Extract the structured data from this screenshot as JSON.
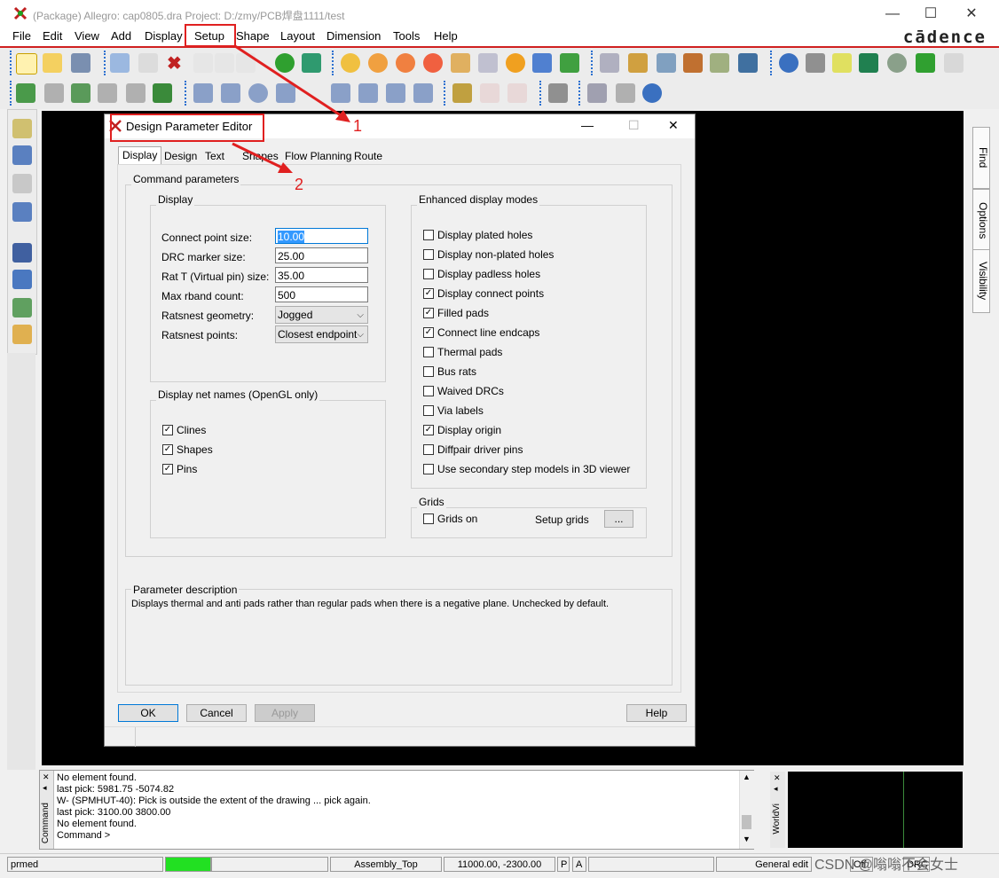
{
  "window": {
    "title": "(Package) Allegro: cap0805.dra  Project: D:/zmy/PCB焊盘1111/test",
    "minimize": "—",
    "maximize": "☐",
    "close": "✕"
  },
  "menu": {
    "items": [
      "File",
      "Edit",
      "View",
      "Add",
      "Display",
      "Setup",
      "Shape",
      "Layout",
      "Dimension",
      "Tools",
      "Help"
    ],
    "brand": "cādence"
  },
  "right_tabs": [
    "Find",
    "Options",
    "Visibility"
  ],
  "dialog": {
    "title": "Design Parameter Editor",
    "tabs": [
      "Display",
      "Design",
      "Text",
      "Shapes",
      "Flow Planning",
      "Route"
    ],
    "active_tab": "Display",
    "command_parameters_label": "Command parameters",
    "display_group": {
      "label": "Display",
      "fields": [
        {
          "label": "Connect point size:",
          "value": "10.00"
        },
        {
          "label": "DRC marker size:",
          "value": "25.00"
        },
        {
          "label": "Rat T (Virtual pin) size:",
          "value": "35.00"
        },
        {
          "label": "Max rband count:",
          "value": "500"
        }
      ],
      "selects": [
        {
          "label": "Ratsnest geometry:",
          "value": "Jogged"
        },
        {
          "label": "Ratsnest points:",
          "value": "Closest endpoint"
        }
      ]
    },
    "net_names_group": {
      "label": "Display net names (OpenGL only)",
      "checks": [
        {
          "label": "Clines",
          "checked": true
        },
        {
          "label": "Shapes",
          "checked": true
        },
        {
          "label": "Pins",
          "checked": true
        }
      ]
    },
    "enhanced_group": {
      "label": "Enhanced display modes",
      "checks": [
        {
          "label": "Display plated holes",
          "checked": false
        },
        {
          "label": "Display non-plated holes",
          "checked": false
        },
        {
          "label": "Display padless holes",
          "checked": false
        },
        {
          "label": "Display connect points",
          "checked": true
        },
        {
          "label": "Filled pads",
          "checked": true
        },
        {
          "label": "Connect line endcaps",
          "checked": true
        },
        {
          "label": "Thermal pads",
          "checked": false
        },
        {
          "label": "Bus rats",
          "checked": false
        },
        {
          "label": "Waived DRCs",
          "checked": false
        },
        {
          "label": "Via labels",
          "checked": false
        },
        {
          "label": "Display origin",
          "checked": true
        },
        {
          "label": "Diffpair driver pins",
          "checked": false
        },
        {
          "label": "Use secondary step models in 3D viewer",
          "checked": false
        }
      ]
    },
    "grids_group": {
      "label": "Grids",
      "grids_on": {
        "label": "Grids on",
        "checked": false
      },
      "setup_label": "Setup grids",
      "setup_button": "..."
    },
    "description": {
      "label": "Parameter description",
      "text": "Displays thermal and anti pads rather than regular pads when there is a negative plane. Unchecked by default."
    },
    "buttons": {
      "ok": "OK",
      "cancel": "Cancel",
      "apply": "Apply",
      "help": "Help"
    }
  },
  "console": {
    "side_label": "Command",
    "lines": [
      "No element found.",
      "last pick:  5981.75 -5074.82",
      "W- (SPMHUT-40): Pick is outside the extent of the drawing ... pick again.",
      "last pick:  3100.00 3800.00",
      "No element found.",
      "Command >"
    ]
  },
  "worldview": {
    "side_label": "WorldVi"
  },
  "statusbar": {
    "command": "prmed",
    "layer": "Assembly_Top",
    "coords": "11000.00, -2300.00",
    "p": "P",
    "a": "A",
    "mode": "General edit",
    "off": "Off",
    "drc": "DRC",
    "watermark": "CSDN @嗡嗡不会女士"
  },
  "annotations": {
    "one": "1",
    "two": "2"
  },
  "colors": {
    "accent_red": "#e02020",
    "status_green": "#22e022"
  }
}
